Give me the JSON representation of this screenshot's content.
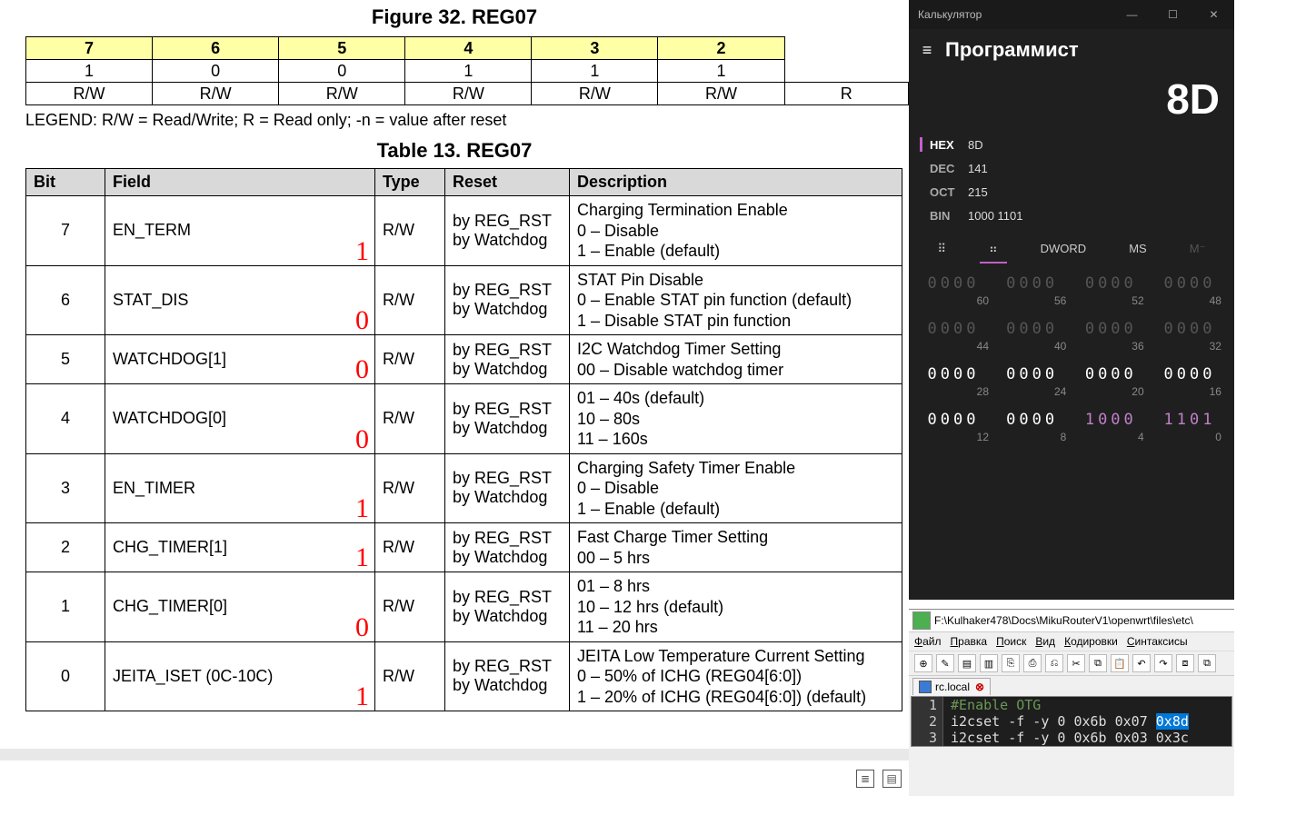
{
  "figure_title": "Figure 32.  REG07",
  "table_title": "Table 13. REG07",
  "legend": "LEGEND: R/W = Read/Write; R = Read only; -n = value after reset",
  "bitmap": {
    "nums": [
      "7",
      "6",
      "5",
      "4",
      "3",
      "2"
    ],
    "vals": [
      "1",
      "0",
      "0",
      "1",
      "1",
      "1"
    ],
    "rw": [
      "R/W",
      "R/W",
      "R/W",
      "R/W",
      "R/W",
      "R/W",
      "R"
    ]
  },
  "reg_headers": {
    "bit": "Bit",
    "field": "Field",
    "type": "Type",
    "reset": "Reset",
    "desc": "Description"
  },
  "reset_text": "by REG_RST\nby Watchdog",
  "rows": [
    {
      "bit": "7",
      "field": "EN_TERM",
      "ann": "1",
      "type": "R/W",
      "desc": [
        "Charging Termination Enable",
        "0 – Disable",
        "1 – Enable (default)"
      ]
    },
    {
      "bit": "6",
      "field": "STAT_DIS",
      "ann": "0",
      "type": "R/W",
      "desc": [
        "STAT Pin Disable",
        "0 – Enable STAT pin function (default)",
        "1 – Disable STAT pin function"
      ]
    },
    {
      "bit": "5",
      "field": "WATCHDOG[1]",
      "ann": "0",
      "type": "R/W",
      "desc": [
        "I2C Watchdog Timer Setting",
        "00 – Disable watchdog timer"
      ]
    },
    {
      "bit": "4",
      "field": "WATCHDOG[0]",
      "ann": "0",
      "type": "R/W",
      "desc": [
        "01 – 40s (default)",
        "10 – 80s",
        "11 – 160s"
      ]
    },
    {
      "bit": "3",
      "field": "EN_TIMER",
      "ann": "1",
      "type": "R/W",
      "desc": [
        "Charging Safety Timer Enable",
        "0 – Disable",
        "1 – Enable (default)"
      ]
    },
    {
      "bit": "2",
      "field": "CHG_TIMER[1]",
      "ann": "1",
      "type": "R/W",
      "desc": [
        "Fast Charge Timer Setting",
        "00 – 5 hrs"
      ]
    },
    {
      "bit": "1",
      "field": "CHG_TIMER[0]",
      "ann": "0",
      "type": "R/W",
      "desc": [
        "01 – 8 hrs",
        "10 – 12 hrs (default)",
        "11 – 20 hrs"
      ]
    },
    {
      "bit": "0",
      "field": "JEITA_ISET (0C-10C)",
      "ann": "1",
      "type": "R/W",
      "desc": [
        "JEITA Low Temperature Current Setting",
        "0 – 50% of ICHG (REG04[6:0])",
        "1 – 20% of ICHG (REG04[6:0]) (default)"
      ]
    }
  ],
  "calc": {
    "window_title": "Калькулятор",
    "mode": "Программист",
    "display": "8D",
    "bases": [
      {
        "label": "HEX",
        "value": "8D",
        "active": true
      },
      {
        "label": "DEC",
        "value": "141",
        "active": false
      },
      {
        "label": "OCT",
        "value": "215",
        "active": false
      },
      {
        "label": "BIN",
        "value": "1000 1101",
        "active": false
      }
    ],
    "opts": {
      "keypad": "⠿",
      "bits": "⠶",
      "word": "DWORD",
      "ms": "MS",
      "mt": "M⁻"
    },
    "bit_rows": [
      {
        "groups": [
          "0000",
          "0000",
          "0000",
          "0000"
        ],
        "style": [
          "dim",
          "dim",
          "dim",
          "dim"
        ],
        "idx": [
          "60",
          "56",
          "52",
          "48"
        ]
      },
      {
        "groups": [
          "0000",
          "0000",
          "0000",
          "0000"
        ],
        "style": [
          "dim",
          "dim",
          "dim",
          "dim"
        ],
        "idx": [
          "44",
          "40",
          "36",
          "32"
        ]
      },
      {
        "groups": [
          "0000",
          "0000",
          "0000",
          "0000"
        ],
        "style": [
          "on",
          "on",
          "on",
          "on"
        ],
        "idx": [
          "28",
          "24",
          "20",
          "16"
        ]
      },
      {
        "groups": [
          "0000",
          "0000",
          "1000",
          "1101"
        ],
        "style": [
          "on",
          "on",
          "hi",
          "hi"
        ],
        "idx": [
          "12",
          "8",
          "4",
          "0"
        ]
      }
    ]
  },
  "editor": {
    "path": "F:\\Kulhaker478\\Docs\\MikuRouterV1\\openwrt\\files\\etc\\",
    "menus": [
      "Файл",
      "Правка",
      "Поиск",
      "Вид",
      "Кодировки",
      "Синтаксисы"
    ],
    "tab": "rc.local",
    "code": [
      {
        "n": "1",
        "text": "#Enable OTG",
        "type": "comment"
      },
      {
        "n": "2",
        "text": "i2cset -f -y 0 0x6b 0x07 ",
        "sel": "0x8d"
      },
      {
        "n": "3",
        "text": "i2cset -f -y 0 0x6b 0x03 0x3c"
      }
    ]
  }
}
